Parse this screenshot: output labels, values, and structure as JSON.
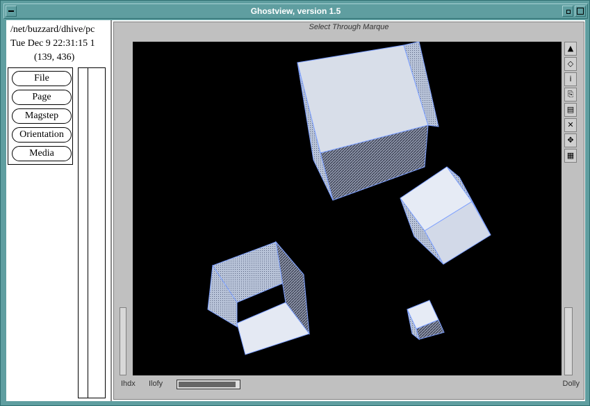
{
  "window": {
    "title": "Ghostview, version 1.5"
  },
  "info": {
    "path": "/net/buzzard/dhive/pc",
    "date": "Tue Dec  9 22:31:15 1",
    "coords": "(139, 436)"
  },
  "menu": [
    {
      "label": "File"
    },
    {
      "label": "Page"
    },
    {
      "label": "Magstep"
    },
    {
      "label": "Orientation"
    },
    {
      "label": "Media"
    }
  ],
  "document": {
    "title": "Select Through Marque",
    "status_left1": "Ihdx",
    "status_left2": "Ilofy",
    "status_right": "Dolly",
    "slider_fraction": 0.95,
    "tools": [
      {
        "icon": "arrow-icon",
        "glyph": "▲"
      },
      {
        "icon": "vertex-icon",
        "glyph": "◇"
      },
      {
        "icon": "info-icon",
        "glyph": "i"
      },
      {
        "icon": "copy-icon",
        "glyph": "⎘"
      },
      {
        "icon": "page-icon",
        "glyph": "▤"
      },
      {
        "icon": "close-icon",
        "glyph": "✕"
      },
      {
        "icon": "move-icon",
        "glyph": "✥"
      },
      {
        "icon": "grid-icon",
        "glyph": "▦"
      }
    ]
  },
  "colors": {
    "frame": "#5f9ea0",
    "canvas": "#000000",
    "box_light": "#d8dee9",
    "box_edge": "#7da0ff"
  }
}
